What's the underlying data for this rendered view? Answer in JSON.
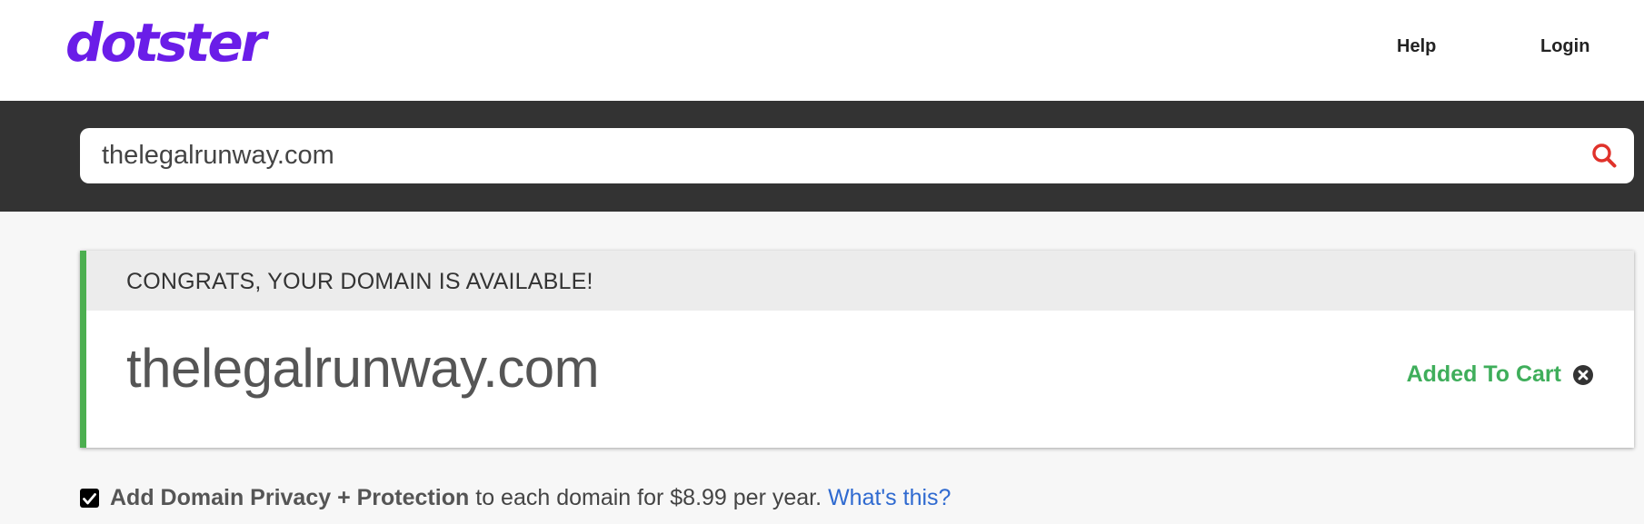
{
  "header": {
    "logo_text": "dotster",
    "nav": {
      "help_label": "Help",
      "login_label": "Login"
    }
  },
  "search": {
    "value": "thelegalrunway.com",
    "icon": "search-icon"
  },
  "result": {
    "banner_text": "CONGRATS, YOUR DOMAIN IS AVAILABLE!",
    "domain": "thelegalrunway.com",
    "status_label": "Added To Cart",
    "remove_icon": "close-circle-icon"
  },
  "privacy": {
    "checked": true,
    "strong_text": "Add Domain Privacy + Protection",
    "rest_text": "to each domain for $8.99 per year.",
    "link_text": "What's this?"
  },
  "colors": {
    "brand": "#6a1de8",
    "accent_green": "#4caf50",
    "added_green": "#3fae5b",
    "search_red": "#e0322b",
    "link_blue": "#2f6ad0",
    "dark_bar": "#333333"
  }
}
